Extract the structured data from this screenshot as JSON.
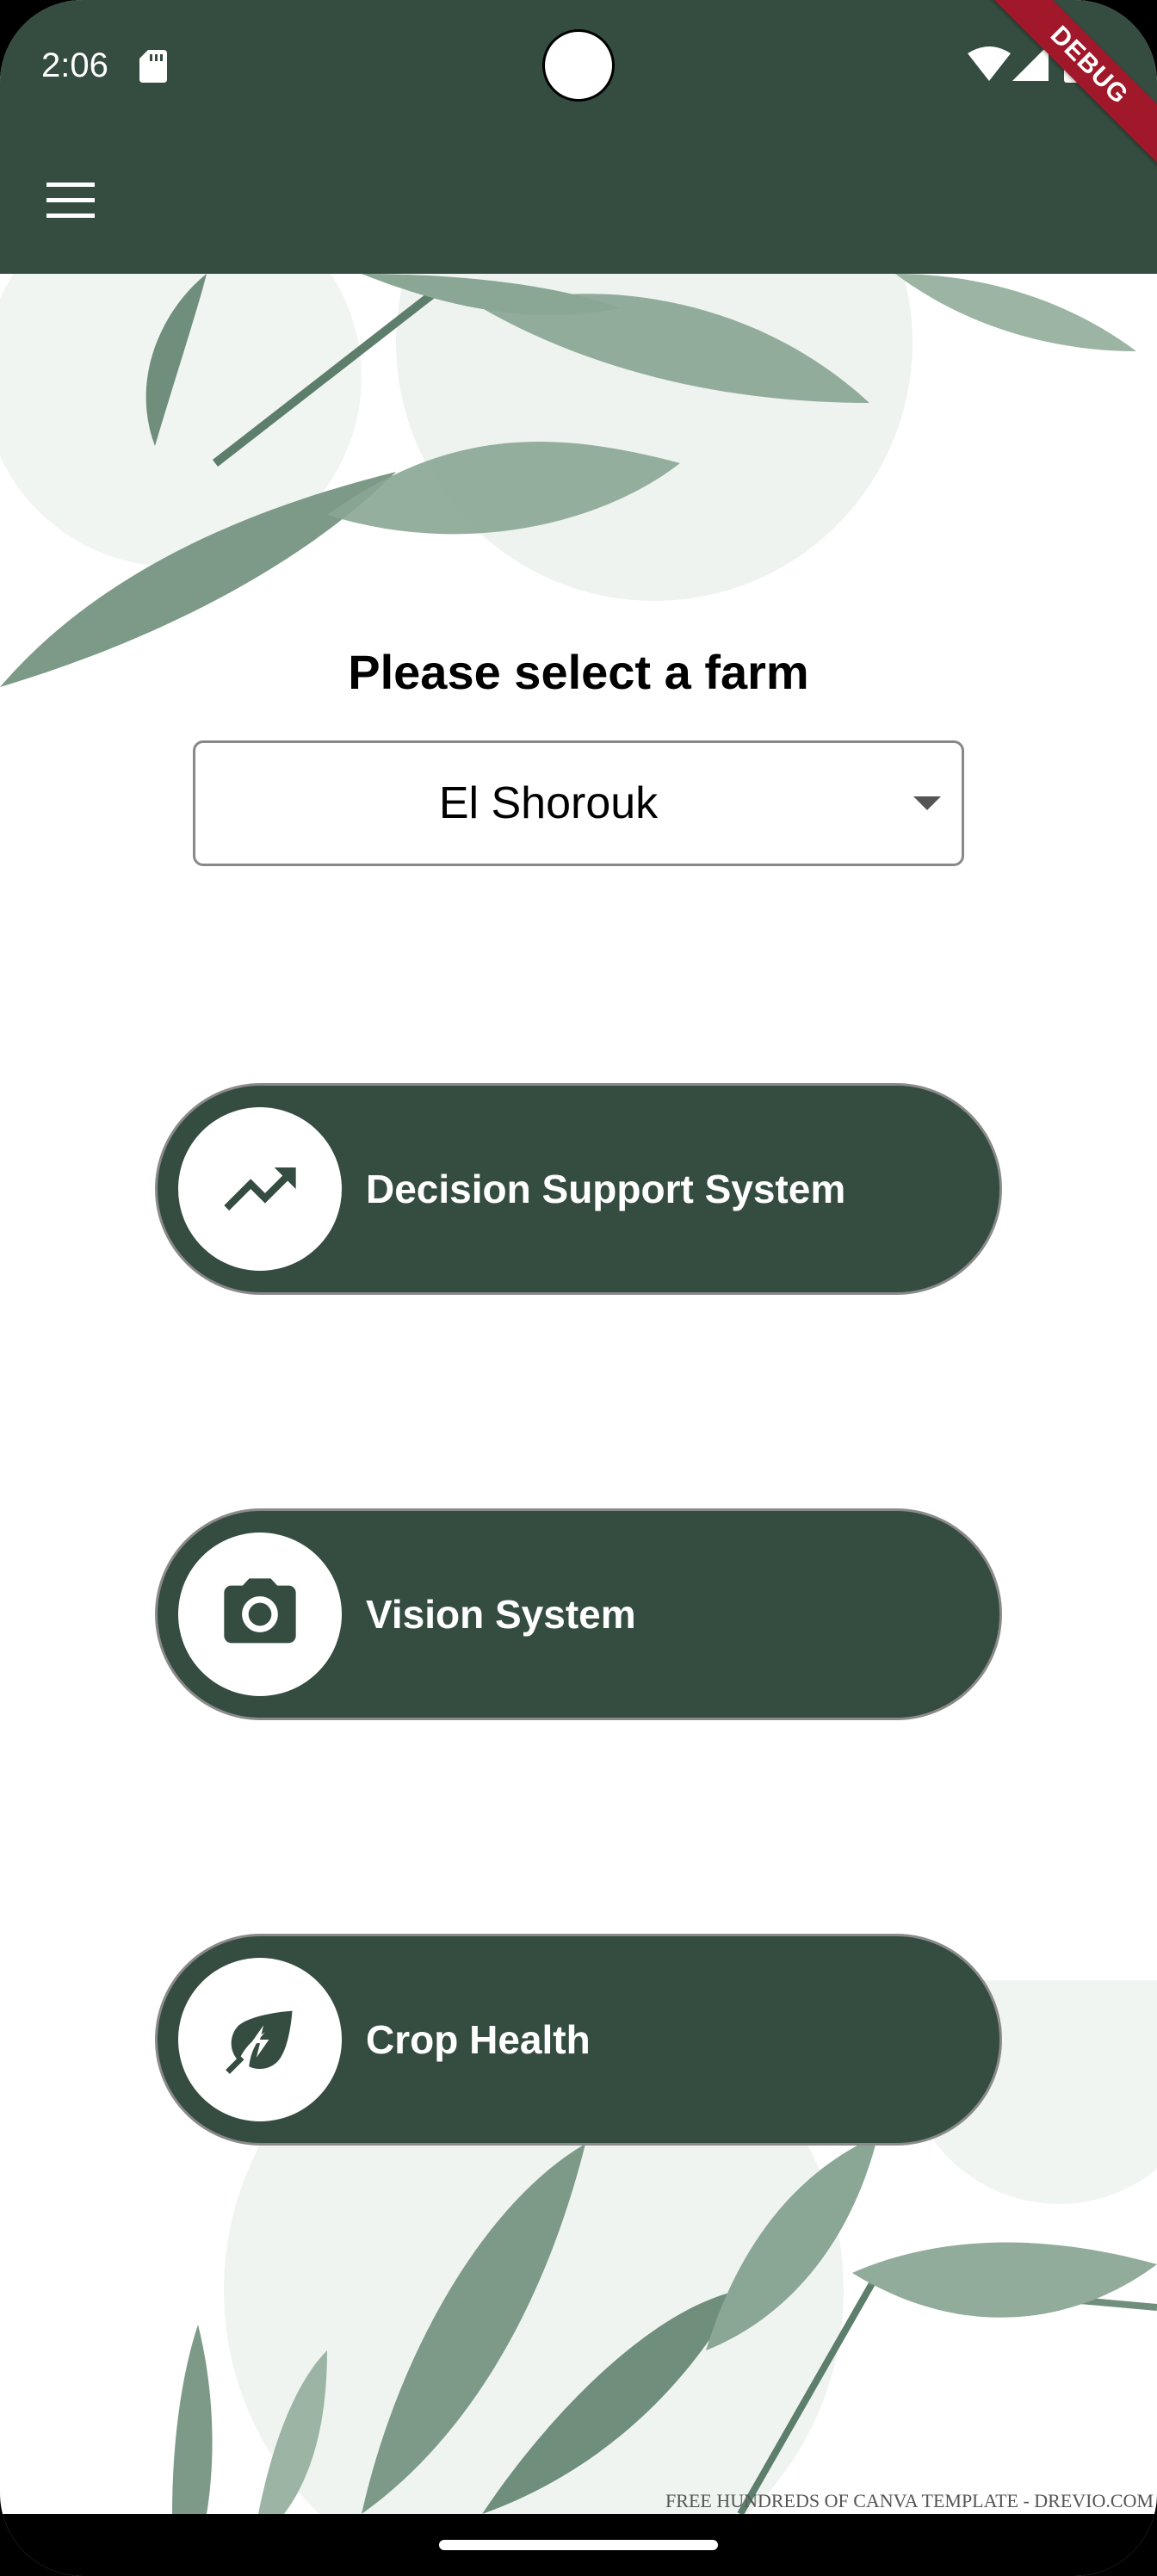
{
  "status_bar": {
    "time": "2:06",
    "icons": [
      "sd-card-icon",
      "wifi-icon",
      "cell-signal-icon",
      "battery-icon"
    ]
  },
  "app_bar": {
    "menu_icon": "hamburger-menu-icon",
    "debug_banner": "DEBUG",
    "background_color": "#354C40"
  },
  "farm_selector": {
    "prompt": "Please select a farm",
    "selected": "El Shorouk",
    "caret_icon": "dropdown-caret-icon"
  },
  "menu": {
    "items": [
      {
        "label": "Decision Support System",
        "icon": "trending-up-icon"
      },
      {
        "label": "Vision System",
        "icon": "camera-icon"
      },
      {
        "label": "Crop Health",
        "icon": "eco-leaf-bolt-icon"
      }
    ]
  },
  "background": {
    "watermark": "FREE HUNDREDS OF CANVA TEMPLATE - DREVIO.COM",
    "decoration": "watercolor-leaves"
  },
  "colors": {
    "primary": "#354C40",
    "debug": "#A0182A",
    "leaf": "#5E7E6C"
  }
}
